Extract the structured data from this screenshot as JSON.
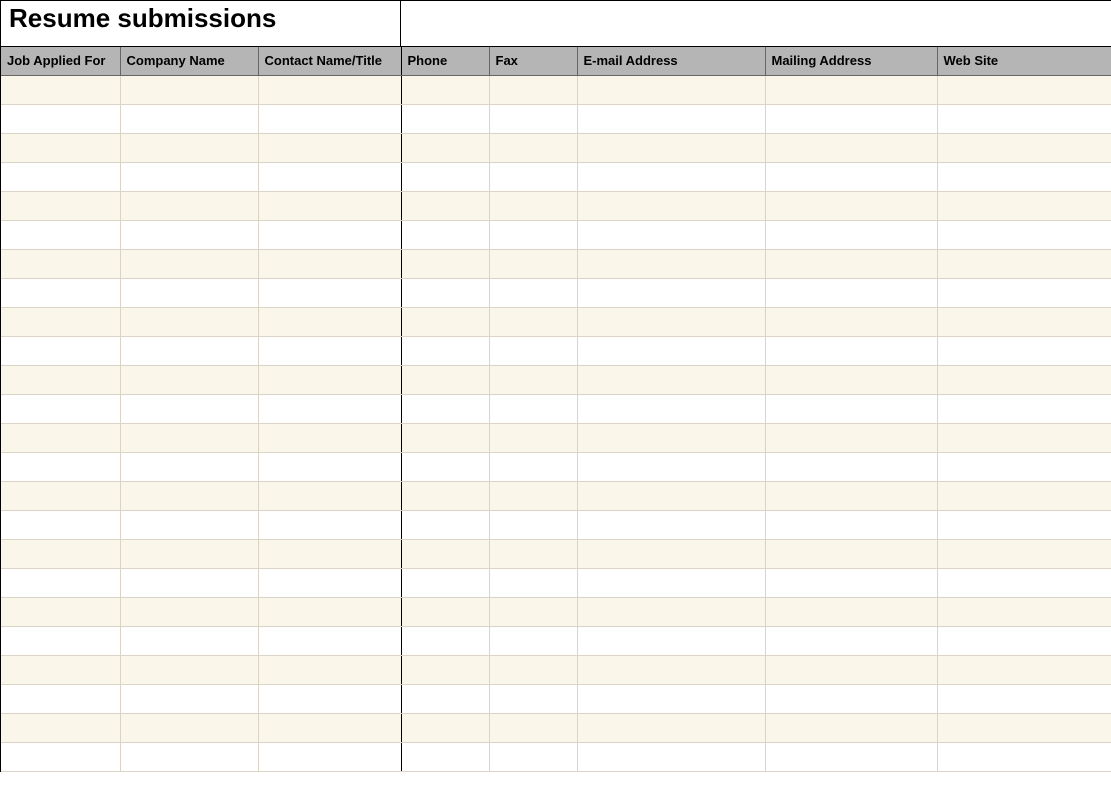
{
  "title": "Resume submissions",
  "columns": [
    "Job Applied For",
    "Company Name",
    "Contact Name/Title",
    "Phone",
    "Fax",
    "E-mail Address",
    "Mailing Address",
    "Web Site"
  ],
  "rows": [
    [
      "",
      "",
      "",
      "",
      "",
      "",
      "",
      ""
    ],
    [
      "",
      "",
      "",
      "",
      "",
      "",
      "",
      ""
    ],
    [
      "",
      "",
      "",
      "",
      "",
      "",
      "",
      ""
    ],
    [
      "",
      "",
      "",
      "",
      "",
      "",
      "",
      ""
    ],
    [
      "",
      "",
      "",
      "",
      "",
      "",
      "",
      ""
    ],
    [
      "",
      "",
      "",
      "",
      "",
      "",
      "",
      ""
    ],
    [
      "",
      "",
      "",
      "",
      "",
      "",
      "",
      ""
    ],
    [
      "",
      "",
      "",
      "",
      "",
      "",
      "",
      ""
    ],
    [
      "",
      "",
      "",
      "",
      "",
      "",
      "",
      ""
    ],
    [
      "",
      "",
      "",
      "",
      "",
      "",
      "",
      ""
    ],
    [
      "",
      "",
      "",
      "",
      "",
      "",
      "",
      ""
    ],
    [
      "",
      "",
      "",
      "",
      "",
      "",
      "",
      ""
    ],
    [
      "",
      "",
      "",
      "",
      "",
      "",
      "",
      ""
    ],
    [
      "",
      "",
      "",
      "",
      "",
      "",
      "",
      ""
    ],
    [
      "",
      "",
      "",
      "",
      "",
      "",
      "",
      ""
    ],
    [
      "",
      "",
      "",
      "",
      "",
      "",
      "",
      ""
    ],
    [
      "",
      "",
      "",
      "",
      "",
      "",
      "",
      ""
    ],
    [
      "",
      "",
      "",
      "",
      "",
      "",
      "",
      ""
    ],
    [
      "",
      "",
      "",
      "",
      "",
      "",
      "",
      ""
    ],
    [
      "",
      "",
      "",
      "",
      "",
      "",
      "",
      ""
    ],
    [
      "",
      "",
      "",
      "",
      "",
      "",
      "",
      ""
    ],
    [
      "",
      "",
      "",
      "",
      "",
      "",
      "",
      ""
    ],
    [
      "",
      "",
      "",
      "",
      "",
      "",
      "",
      ""
    ],
    [
      "",
      "",
      "",
      "",
      "",
      "",
      "",
      ""
    ]
  ]
}
